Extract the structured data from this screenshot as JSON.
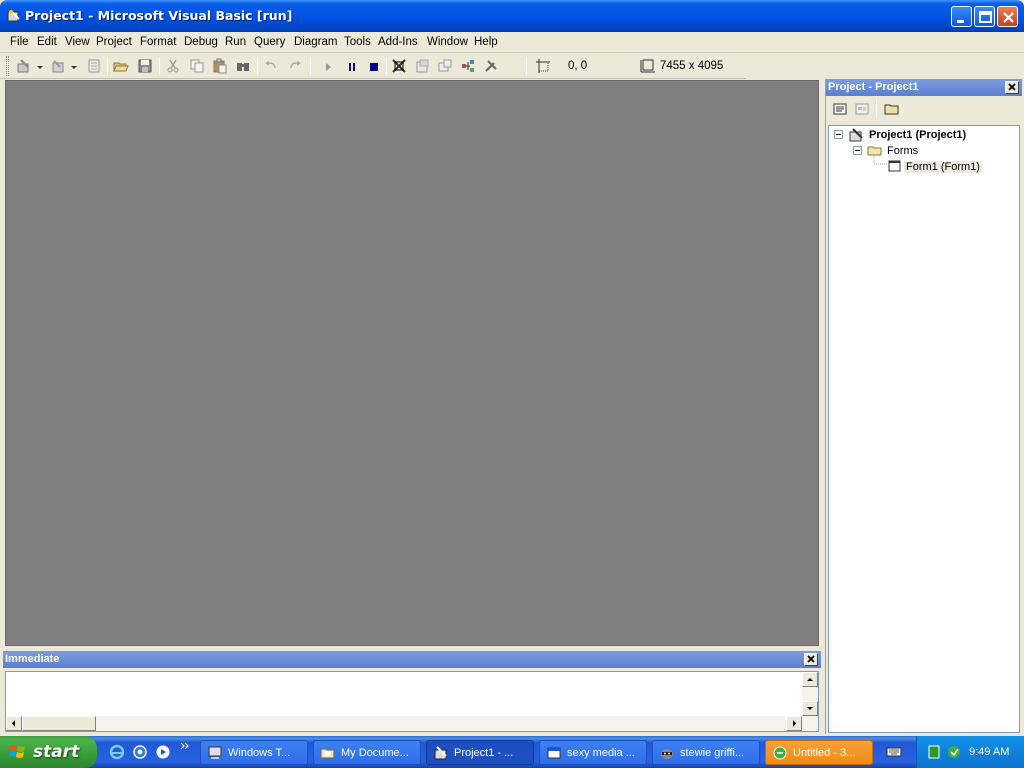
{
  "window": {
    "title": "Project1 - Microsoft Visual Basic [run]"
  },
  "menu": {
    "items": [
      "File",
      "Edit",
      "View",
      "Project",
      "Format",
      "Debug",
      "Run",
      "Query",
      "Diagram",
      "Tools",
      "Add-Ins",
      "Window",
      "Help"
    ]
  },
  "toolbar": {
    "position_readout": "0, 0",
    "size_readout": "7455 x 4095"
  },
  "immediate": {
    "title": "Immediate"
  },
  "project_explorer": {
    "title": "Project - Project1",
    "tree": {
      "project": "Project1 (Project1)",
      "folder": "Forms",
      "form": "Form1 (Form1)"
    }
  },
  "taskbar": {
    "start_label": "start",
    "tasks": [
      {
        "label": "Windows T...",
        "icon": "computer-icon"
      },
      {
        "label": "My Docume...",
        "icon": "folder-icon"
      },
      {
        "label": "Project1 - ...",
        "icon": "vb-icon"
      },
      {
        "label": "sexy media ...",
        "icon": "window-icon"
      },
      {
        "label": "stewie griffi...",
        "icon": "raccoon-icon"
      },
      {
        "label": "Untitled - 3...",
        "icon": "chat-icon"
      }
    ],
    "clock": "9:49 AM"
  },
  "colors": {
    "title_blue": "#0054e3",
    "mdi_gray": "#808080",
    "panel_title": "#6e8ed8",
    "taskbar_blue": "#2663e0",
    "start_green": "#3c9a3c",
    "flash_orange": "#f08a14"
  }
}
